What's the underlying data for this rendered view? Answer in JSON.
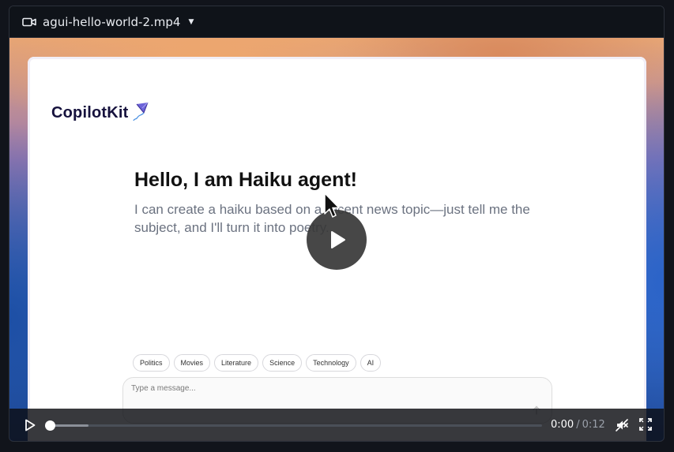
{
  "title_bar": {
    "filename": "agui-hello-world-2.mp4",
    "file_icon": "video-camera-icon",
    "dropdown_icon": "caret-down-icon"
  },
  "app": {
    "logo_text": "CopilotKit",
    "logo_icon": "kite-icon",
    "heading": "Hello, I am Haiku agent!",
    "subtext": "I can create a haiku based on a recent news topic—just tell me the subject, and I'll turn it into poetry.",
    "chips": [
      "Politics",
      "Movies",
      "Literature",
      "Science",
      "Technology",
      "AI"
    ],
    "message_placeholder": "Type a message...",
    "send_icon": "arrow-up-icon"
  },
  "player": {
    "current_time": "0:00",
    "separator": "/",
    "duration": "0:12",
    "progress": 0.0,
    "buffered": 0.08,
    "play_icon": "play-icon",
    "mute_icon": "volume-muted-icon",
    "fullscreen_icon": "fullscreen-icon",
    "overlay_icon": "big-play-icon",
    "cursor_icon": "mouse-cursor-icon"
  },
  "colors": {
    "accent": "#16123d",
    "page_background": "#11141b",
    "controls_background": "#0c0e12"
  }
}
